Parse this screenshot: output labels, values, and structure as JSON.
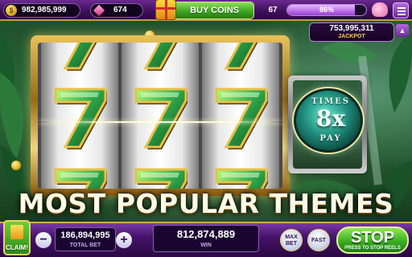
{
  "colors": {
    "bar_purple": "#45136a",
    "gold": "#d8a84a",
    "green_button": "#3cae22",
    "seven_green": "#2fa84a"
  },
  "top_bar": {
    "coins": "982,985,999",
    "coin_icon": "coin-icon",
    "gems": "674",
    "gem_icon": "gem-icon",
    "buy_coins_label": "BUY COINS",
    "level": "67",
    "xp_percent_label": "86%",
    "xp_fraction": 0.86,
    "piggy_icon": "piggy-bank-icon",
    "menu_icon": "menu-icon"
  },
  "jackpot": {
    "value": "753,995,311",
    "label": "JACKPOT"
  },
  "reels": {
    "symbol": "7",
    "symbols_per_reel": [
      "7",
      "7",
      "7"
    ]
  },
  "multiplier_panel": {
    "top_word": "TIMES",
    "value": "8x",
    "bottom_word": "PAY"
  },
  "banner": {
    "text": "MOST POPULAR THEMES"
  },
  "bottom_bar": {
    "claim_label": "CLAIM!",
    "minus_label": "−",
    "plus_label": "+",
    "total_bet_value": "186,894,995",
    "total_bet_label": "TOTAL BET",
    "win_value": "812,874,889",
    "win_label": "WIN",
    "max_bet_line1": "MAX",
    "max_bet_line2": "BET",
    "fast_label": "FAST",
    "stop_label": "STOP",
    "stop_sub": "PRESS TO STOP REELS"
  }
}
